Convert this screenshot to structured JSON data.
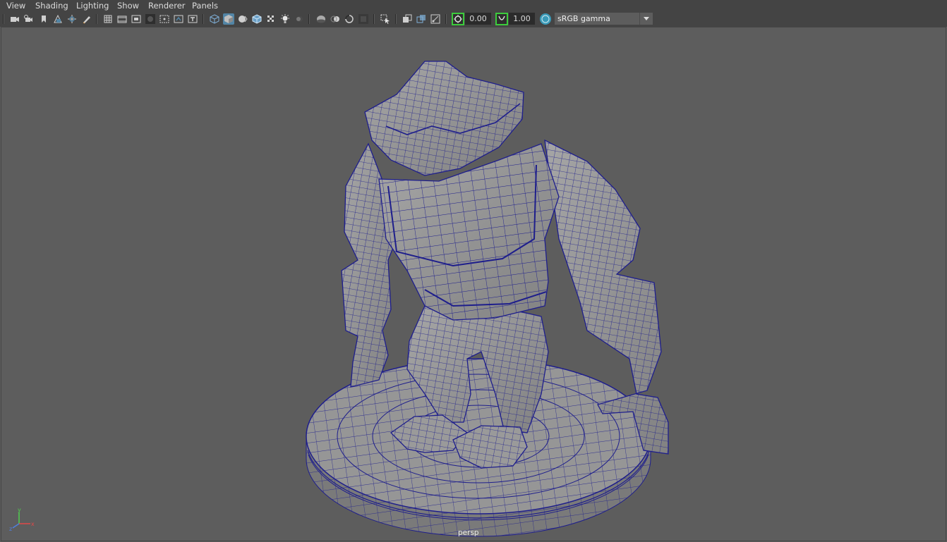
{
  "menu": {
    "view": "View",
    "shading": "Shading",
    "lighting": "Lighting",
    "show": "Show",
    "renderer": "Renderer",
    "panels": "Panels"
  },
  "toolbar": {
    "exposure_value": "0.00",
    "gamma_value": "1.00",
    "color_space": "sRGB gamma",
    "icons": [
      "camera-select-icon",
      "camera-attributes-icon",
      "bookmark-icon",
      "image-plane-icon",
      "2d-pan-zoom-icon",
      "grease-pencil-icon",
      "grid-icon",
      "film-gate-icon",
      "resolution-gate-icon",
      "gate-mask-icon",
      "field-chart-icon",
      "safe-action-icon",
      "safe-title-icon",
      "wireframe-icon",
      "smooth-shade-icon",
      "use-default-material-icon",
      "wireframe-on-shaded-icon",
      "textured-icon",
      "use-all-lights-icon",
      "shadows-icon",
      "screen-space-ao-icon",
      "motion-blur-icon",
      "multisample-aa-icon",
      "depth-of-field-icon",
      "isolate-select-icon",
      "xray-icon",
      "xray-active-components-icon",
      "xray-joints-icon",
      "exposure-icon",
      "gamma-icon",
      "color-management-icon"
    ]
  },
  "viewport": {
    "camera_label": "persp",
    "axis_y": "y",
    "axis_x": "x",
    "axis_z": "z"
  },
  "colors": {
    "background": "#5d5d5d",
    "chrome": "#444444",
    "mesh_fill": "#8c8c8c",
    "wire": "#1e1e8c",
    "active_tool": "#5285a6",
    "highlight_green": "#3ccc3c"
  }
}
